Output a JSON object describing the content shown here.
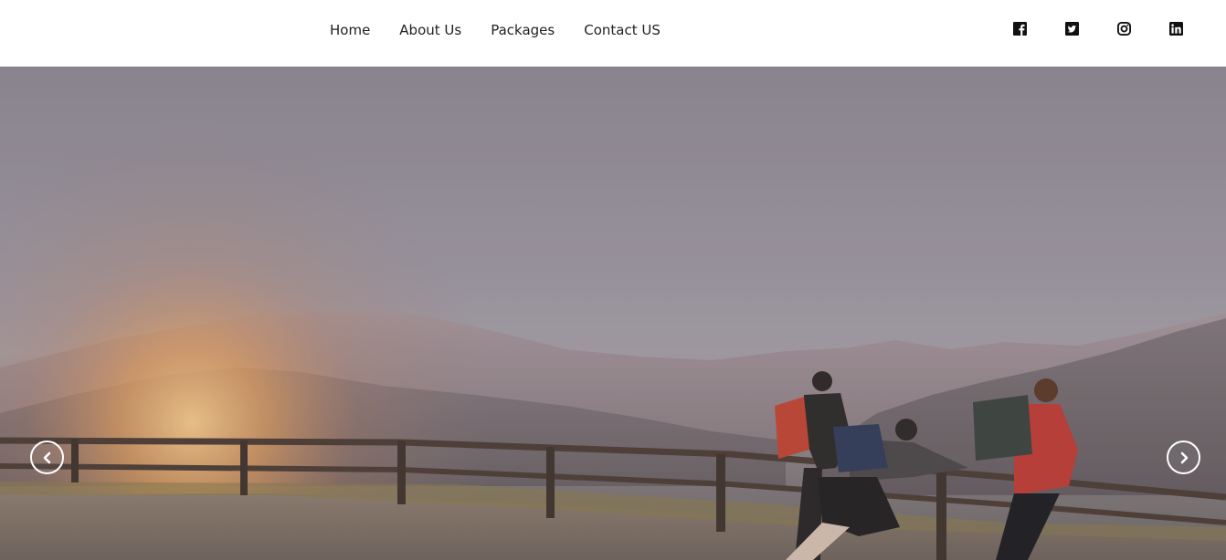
{
  "nav": {
    "links": [
      {
        "label": "Home"
      },
      {
        "label": "About Us"
      },
      {
        "label": "Packages"
      },
      {
        "label": "Contact US"
      }
    ]
  },
  "social": {
    "icons": [
      "facebook-icon",
      "twitter-icon",
      "instagram-icon",
      "linkedin-icon"
    ],
    "color": "#111111"
  },
  "hero": {
    "prev_icon": "chevron-left-icon",
    "next_icon": "chevron-right-icon"
  }
}
